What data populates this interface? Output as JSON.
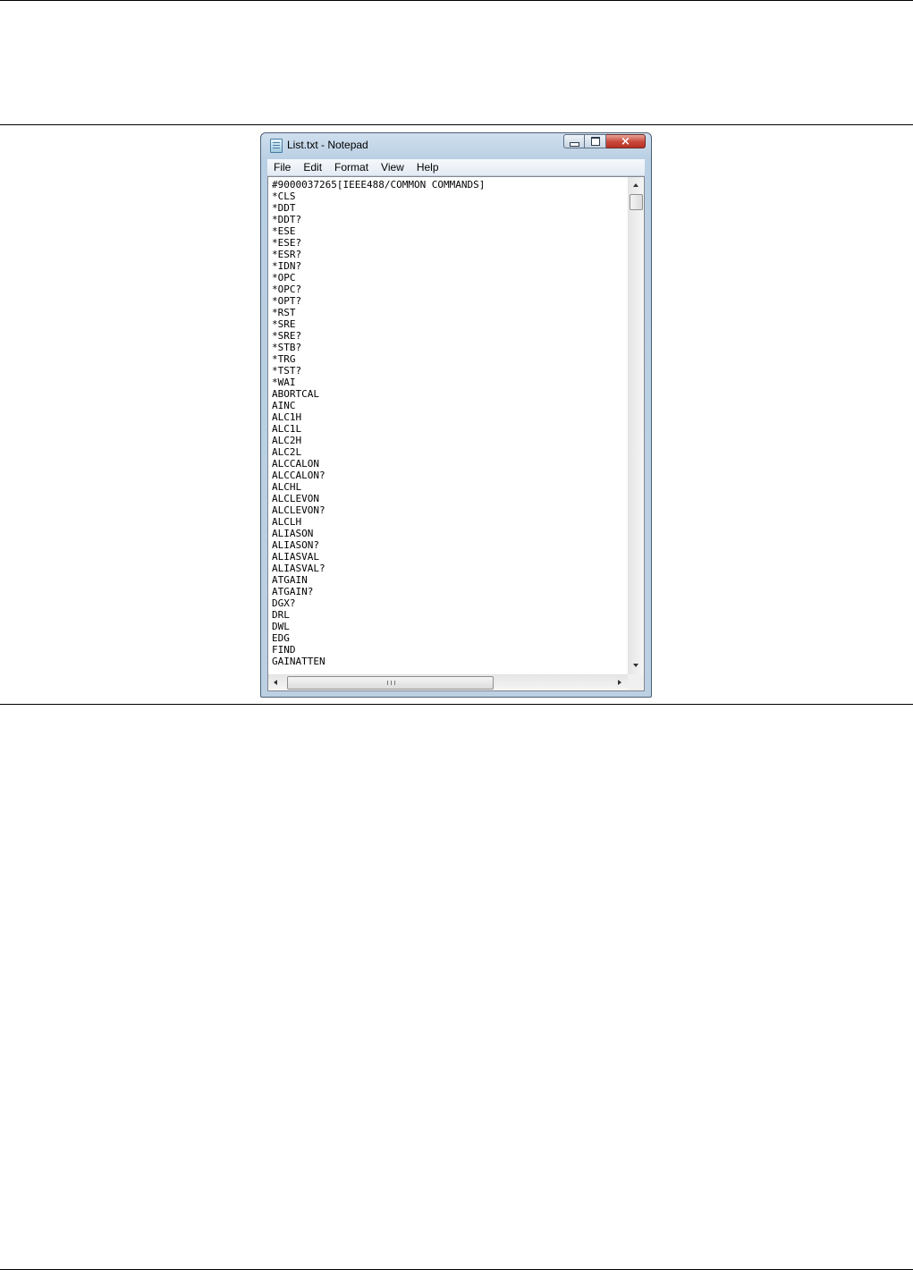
{
  "window": {
    "title": "List.txt - Notepad"
  },
  "menu": [
    "File",
    "Edit",
    "Format",
    "View",
    "Help"
  ],
  "caption_buttons": {
    "minimize": "minimize-icon",
    "maximize": "maximize-icon",
    "close": "×"
  },
  "document": {
    "lines": [
      "#9000037265[IEEE488/COMMON COMMANDS]",
      "*CLS",
      "*DDT",
      "*DDT?",
      "*ESE",
      "*ESE?",
      "*ESR?",
      "*IDN?",
      "*OPC",
      "*OPC?",
      "*OPT?",
      "*RST",
      "*SRE",
      "*SRE?",
      "*STB?",
      "*TRG",
      "*TST?",
      "*WAI",
      "ABORTCAL",
      "AINC",
      "ALC1H",
      "ALC1L",
      "ALC2H",
      "ALC2L",
      "ALCCALON",
      "ALCCALON?",
      "ALCHL",
      "ALCLEVON",
      "ALCLEVON?",
      "ALCLH",
      "ALIASON",
      "ALIASON?",
      "ALIASVAL",
      "ALIASVAL?",
      "ATGAIN",
      "ATGAIN?",
      "DGX?",
      "DRL",
      "DWL",
      "EDG",
      "FIND",
      "GAINATTEN"
    ]
  },
  "scrollbars": {
    "h_grip": "III"
  }
}
